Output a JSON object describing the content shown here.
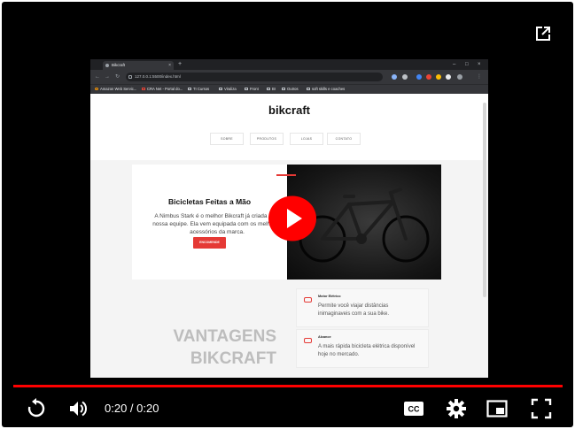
{
  "browser": {
    "tab_title": "Bikcraft",
    "url": "127.0.0.1:5500/index.html",
    "bookmarks": [
      "Amazon Web Servic...",
      "CRA Net - Portal do...",
      "TI Cursos",
      "Viraliza",
      "Front",
      "BI",
      "Outros",
      "soft skills e coaches"
    ]
  },
  "site": {
    "logo": "bikcraft",
    "menu": [
      "SOBRE",
      "PRODUTOS",
      "LOJAS",
      "CONTATO"
    ],
    "hero": {
      "title": "Bicicletas Feitas a Mão",
      "text": "A Nimbus Stark é o melhor Bikcraft já criada pela nossa equipe. Ela vem equipada com os melhores acessórios da marca.",
      "button": "ENCOMENDE"
    },
    "features": [
      {
        "title": "Motor Elétrico",
        "text": "Permite você viajar distâncias inimaginaveis com a sua bike."
      },
      {
        "title": "Alcance",
        "text": "A mais rápida bicicleta elétrica disponível hoje no mercado."
      }
    ],
    "section_title_1": "VANTAGENS",
    "section_title_2": "BIKCRAFT"
  },
  "player": {
    "time_display": "0:20 / 0:20",
    "progress_fraction": 1.0,
    "accent_color": "#ff0000",
    "icons": [
      "popout-icon",
      "play-icon",
      "replay-icon",
      "volume-icon",
      "captions-icon",
      "settings-icon",
      "miniplayer-icon",
      "fullscreen-icon"
    ]
  }
}
